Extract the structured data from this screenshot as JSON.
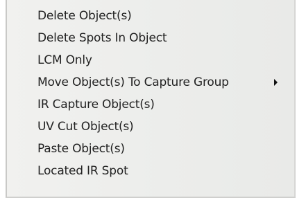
{
  "menu": {
    "items": [
      {
        "label": "Delete Object(s)"
      },
      {
        "label": "Delete Spots In Object"
      },
      {
        "label": "LCM Only"
      },
      {
        "label": "Move Object(s) To Capture Group",
        "submenu_icon": "submenu-arrow-icon"
      },
      {
        "label": "IR Capture Object(s)"
      },
      {
        "label": "UV Cut Object(s)"
      },
      {
        "label": "Paste Object(s)"
      },
      {
        "label": "Located IR Spot"
      }
    ]
  }
}
